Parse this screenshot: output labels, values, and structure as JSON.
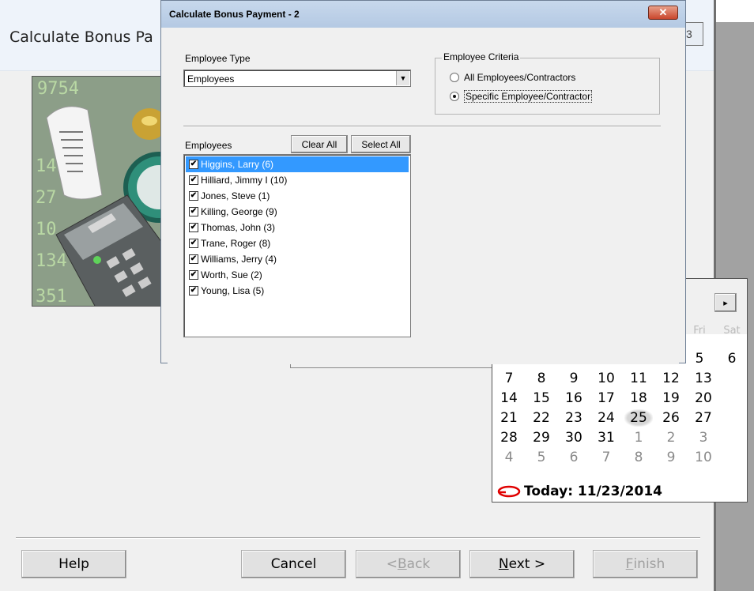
{
  "background_window": {
    "title": "Calculate Bonus Pa",
    "close_fragment": "3",
    "buttons": {
      "help": "Help",
      "cancel": "Cancel",
      "back_prefix": "< ",
      "back_key": "B",
      "back_rest": "ack",
      "next_key": "N",
      "next_rest": "ext >",
      "finish_key": "F",
      "finish_rest": "inish"
    }
  },
  "calendar": {
    "next_icon": "triangle-right-icon",
    "day_headers": [
      "Fri",
      "Sat"
    ],
    "weeks": [
      [
        "7",
        "8",
        "9",
        "10",
        "11",
        "12",
        "13"
      ],
      [
        "14",
        "15",
        "16",
        "17",
        "18",
        "19",
        "20"
      ],
      [
        "21",
        "22",
        "23",
        "24",
        "25",
        "26",
        "27"
      ],
      [
        "28",
        "29",
        "30",
        "31",
        "1",
        "2",
        "3"
      ],
      [
        "4",
        "5",
        "6",
        "7",
        "8",
        "9",
        "10"
      ]
    ],
    "first_week_visible": [
      "5",
      "6"
    ],
    "selected_day": "25",
    "today_label": "Today: 11/23/2014",
    "today_mark_color": "#e00000"
  },
  "dialog": {
    "title": "Calculate Bonus Payment - 2",
    "employee_type_label": "Employee Type",
    "employee_type_value": "Employees",
    "criteria_legend": "Employee Criteria",
    "criteria_options": [
      {
        "label": "All Employees/Contractors",
        "selected": false
      },
      {
        "label": "Specific Employee/Contractor",
        "selected": true
      }
    ],
    "employees_label": "Employees",
    "clear_all": "Clear All",
    "select_all": "Select All",
    "employees": [
      {
        "name": "Higgins, Larry  (6)",
        "checked": true,
        "selected": true
      },
      {
        "name": "Hilliard, Jimmy I (10)",
        "checked": true,
        "selected": false
      },
      {
        "name": "Jones, Steve  (1)",
        "checked": true,
        "selected": false
      },
      {
        "name": "Killing, George  (9)",
        "checked": true,
        "selected": false
      },
      {
        "name": "Thomas, John  (3)",
        "checked": true,
        "selected": false
      },
      {
        "name": "Trane, Roger  (8)",
        "checked": true,
        "selected": false
      },
      {
        "name": "Williams, Jerry  (4)",
        "checked": true,
        "selected": false
      },
      {
        "name": "Worth, Sue  (2)",
        "checked": true,
        "selected": false
      },
      {
        "name": "Young, Lisa  (5)",
        "checked": true,
        "selected": false
      }
    ],
    "colors": {
      "selection": "#3399ff",
      "close_button": "#c9462c"
    }
  }
}
